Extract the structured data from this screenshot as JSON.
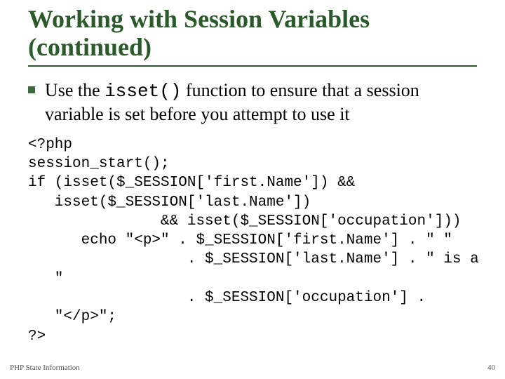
{
  "title": "Working with Session Variables (continued)",
  "bullet": {
    "pre": "Use the ",
    "code": "isset()",
    "post": " function to ensure that a session variable is set before you attempt to use it"
  },
  "code": {
    "l1": "<?php",
    "l2": "session_start();",
    "l3": "if (isset($_SESSION['first.Name']) &&",
    "l4": "   isset($_SESSION['last.Name'])",
    "l5": "               && isset($_SESSION['occupation']))",
    "l6": "      echo \"<p>\" . $_SESSION['first.Name'] . \" \"",
    "l7": "                  . $_SESSION['last.Name'] . \" is a",
    "l8": "   \"",
    "l9": "                  . $_SESSION['occupation'] .",
    "l10": "   \"</p>\";",
    "l11": "?>"
  },
  "footer": {
    "left": "PHP State Information",
    "right": "40"
  }
}
